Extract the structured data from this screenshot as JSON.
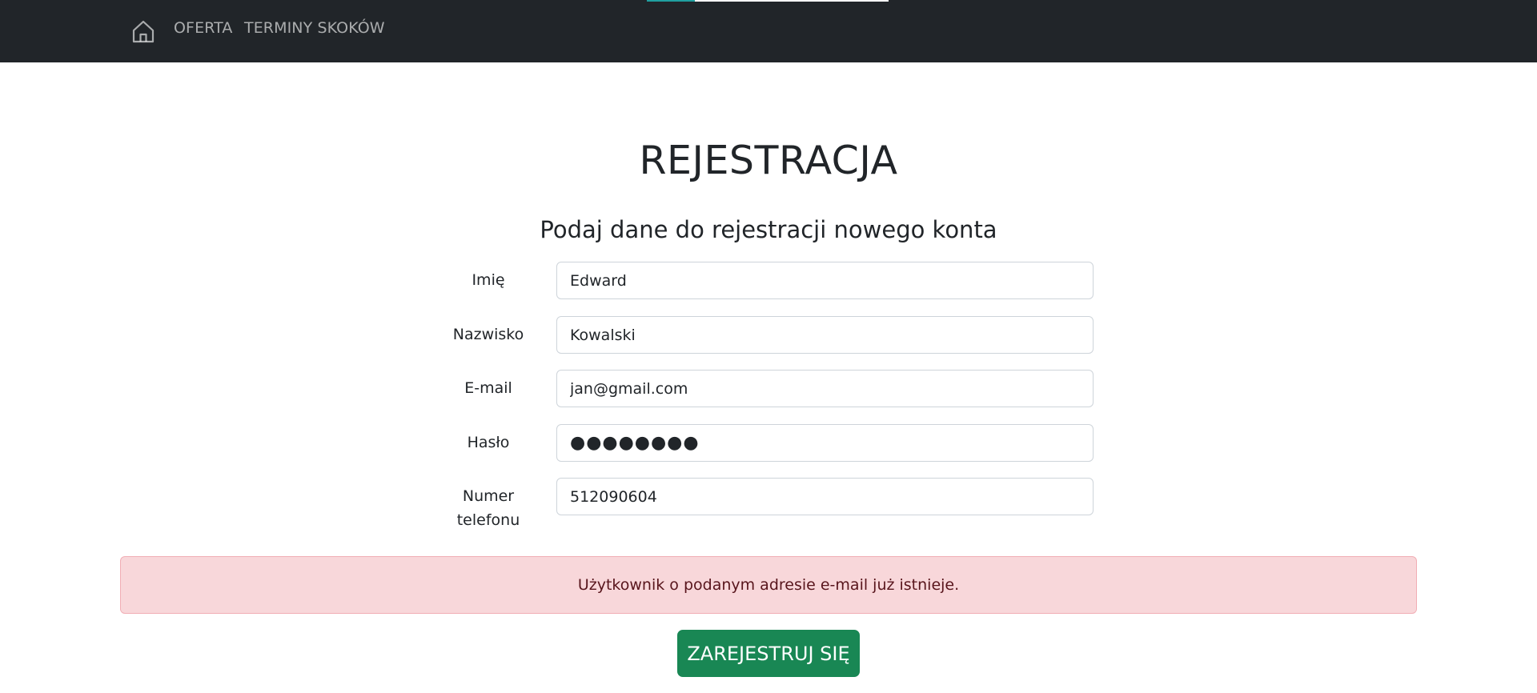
{
  "navbar": {
    "home_icon": "home-icon",
    "links": [
      {
        "label": "OFERTA"
      },
      {
        "label": "TERMINY SKOKÓW"
      }
    ]
  },
  "page": {
    "title": "REJESTRACJA",
    "subtitle": "Podaj dane do rejestracji nowego konta"
  },
  "form": {
    "fields": [
      {
        "label": "Imię",
        "value": "Edward"
      },
      {
        "label": "Nazwisko",
        "value": "Kowalski"
      },
      {
        "label": "E-mail",
        "value": "jan@gmail.com"
      },
      {
        "label": "Hasło",
        "value": "●●●●●●●●"
      },
      {
        "label_line1": "Numer",
        "label_line2": "telefonu",
        "value": "512090604"
      }
    ],
    "submit_label": "ZAREJESTRUJ SIĘ"
  },
  "alert": {
    "message": "Użytkownik o podanym adresie e-mail już istnieje."
  },
  "colors": {
    "navbar_bg": "#212529",
    "alert_bg": "#f8d7da",
    "alert_text": "#58151c",
    "button_bg": "#198754"
  }
}
